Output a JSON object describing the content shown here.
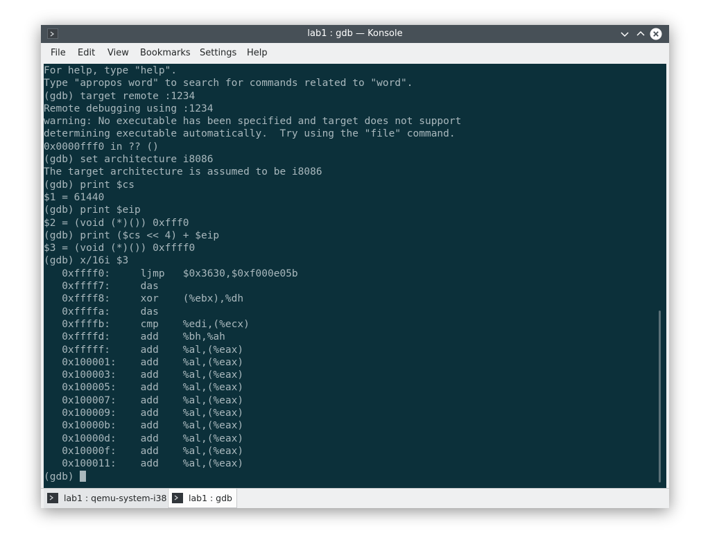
{
  "window": {
    "title": "lab1 : gdb — Konsole"
  },
  "menubar": {
    "items": [
      {
        "label": "File"
      },
      {
        "label": "Edit"
      },
      {
        "label": "View"
      },
      {
        "label": "Bookmarks"
      },
      {
        "label": "Settings"
      },
      {
        "label": "Help"
      }
    ]
  },
  "terminal": {
    "lines": [
      "For help, type \"help\".",
      "Type \"apropos word\" to search for commands related to \"word\".",
      "(gdb) target remote :1234",
      "Remote debugging using :1234",
      "warning: No executable has been specified and target does not support",
      "determining executable automatically.  Try using the \"file\" command.",
      "0x0000fff0 in ?? ()",
      "(gdb) set architecture i8086",
      "The target architecture is assumed to be i8086",
      "(gdb) print $cs",
      "$1 = 61440",
      "(gdb) print $eip",
      "$2 = (void (*)()) 0xfff0",
      "(gdb) print ($cs << 4) + $eip",
      "$3 = (void (*)()) 0xffff0",
      "(gdb) x/16i $3",
      "   0xffff0:     ljmp   $0x3630,$0xf000e05b",
      "   0xffff7:     das",
      "   0xffff8:     xor    (%ebx),%dh",
      "   0xffffa:     das",
      "   0xffffb:     cmp    %edi,(%ecx)",
      "   0xffffd:     add    %bh,%ah",
      "   0xfffff:     add    %al,(%eax)",
      "   0x100001:    add    %al,(%eax)",
      "   0x100003:    add    %al,(%eax)",
      "   0x100005:    add    %al,(%eax)",
      "   0x100007:    add    %al,(%eax)",
      "   0x100009:    add    %al,(%eax)",
      "   0x10000b:    add    %al,(%eax)",
      "   0x10000d:    add    %al,(%eax)",
      "   0x10000f:    add    %al,(%eax)",
      "   0x100011:    add    %al,(%eax)"
    ],
    "prompt": "(gdb) "
  },
  "tabs": [
    {
      "label": "lab1 : qemu-system-i38",
      "active": false
    },
    {
      "label": "lab1 : gdb",
      "active": true
    }
  ],
  "colors": {
    "terminal_bg": "#0c303a",
    "terminal_fg": "#a9b8bd",
    "titlebar_bg": "#475057",
    "close_button": "#ffffff"
  },
  "icons": {
    "app": "terminal-icon",
    "minimize": "chevron-down-icon",
    "maximize": "chevron-up-icon",
    "close": "close-icon"
  }
}
